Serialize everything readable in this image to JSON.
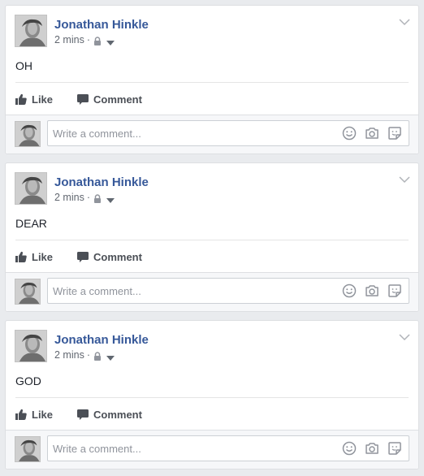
{
  "posts": [
    {
      "author": "Jonathan Hinkle",
      "time": "2 mins",
      "separator": "·",
      "text": "OH",
      "like_label": "Like",
      "comment_label": "Comment",
      "comment_placeholder": "Write a comment..."
    },
    {
      "author": "Jonathan Hinkle",
      "time": "2 mins",
      "separator": "·",
      "text": "DEAR",
      "like_label": "Like",
      "comment_label": "Comment",
      "comment_placeholder": "Write a comment..."
    },
    {
      "author": "Jonathan Hinkle",
      "time": "2 mins",
      "separator": "·",
      "text": "GOD",
      "like_label": "Like",
      "comment_label": "Comment",
      "comment_placeholder": "Write a comment..."
    }
  ],
  "icons": {
    "privacy": "lock-icon",
    "audience": "caret-down-icon",
    "menu": "chevron-down-icon",
    "like": "thumbs-up-icon",
    "comment": "speech-bubble-icon",
    "emoji": "smiley-icon",
    "photo": "camera-icon",
    "sticker": "sticker-icon"
  },
  "colors": {
    "author": "#365899",
    "background": "#e9ebee",
    "meta": "#616770",
    "action": "#4b4f56"
  }
}
